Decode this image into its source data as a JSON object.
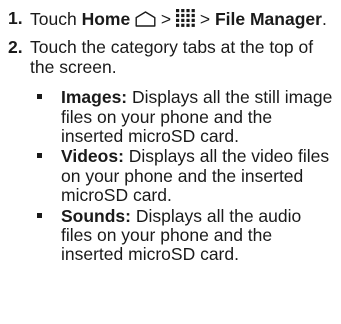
{
  "steps": [
    {
      "number": "1.",
      "text_touch": "Touch ",
      "home_label": "Home",
      "separator_1": " > ",
      "separator_2": " > ",
      "file_manager_label": "File Manager",
      "end_period": "."
    },
    {
      "number": "2.",
      "text": "Touch the category tabs at the top of the screen."
    }
  ],
  "categories": [
    {
      "title": "Images:",
      "description": " Displays all the still image files on your phone and the inserted microSD card."
    },
    {
      "title": "Videos:",
      "description": " Displays all the video files on your phone and the inserted microSD card."
    },
    {
      "title": "Sounds:",
      "description": " Displays all the audio files on your phone and the inserted microSD card."
    }
  ],
  "icons": {
    "home": "home-outline-icon",
    "apps": "apps-grid-icon"
  },
  "colors": {
    "text": "#1a1a1a",
    "background": "#ffffff"
  }
}
